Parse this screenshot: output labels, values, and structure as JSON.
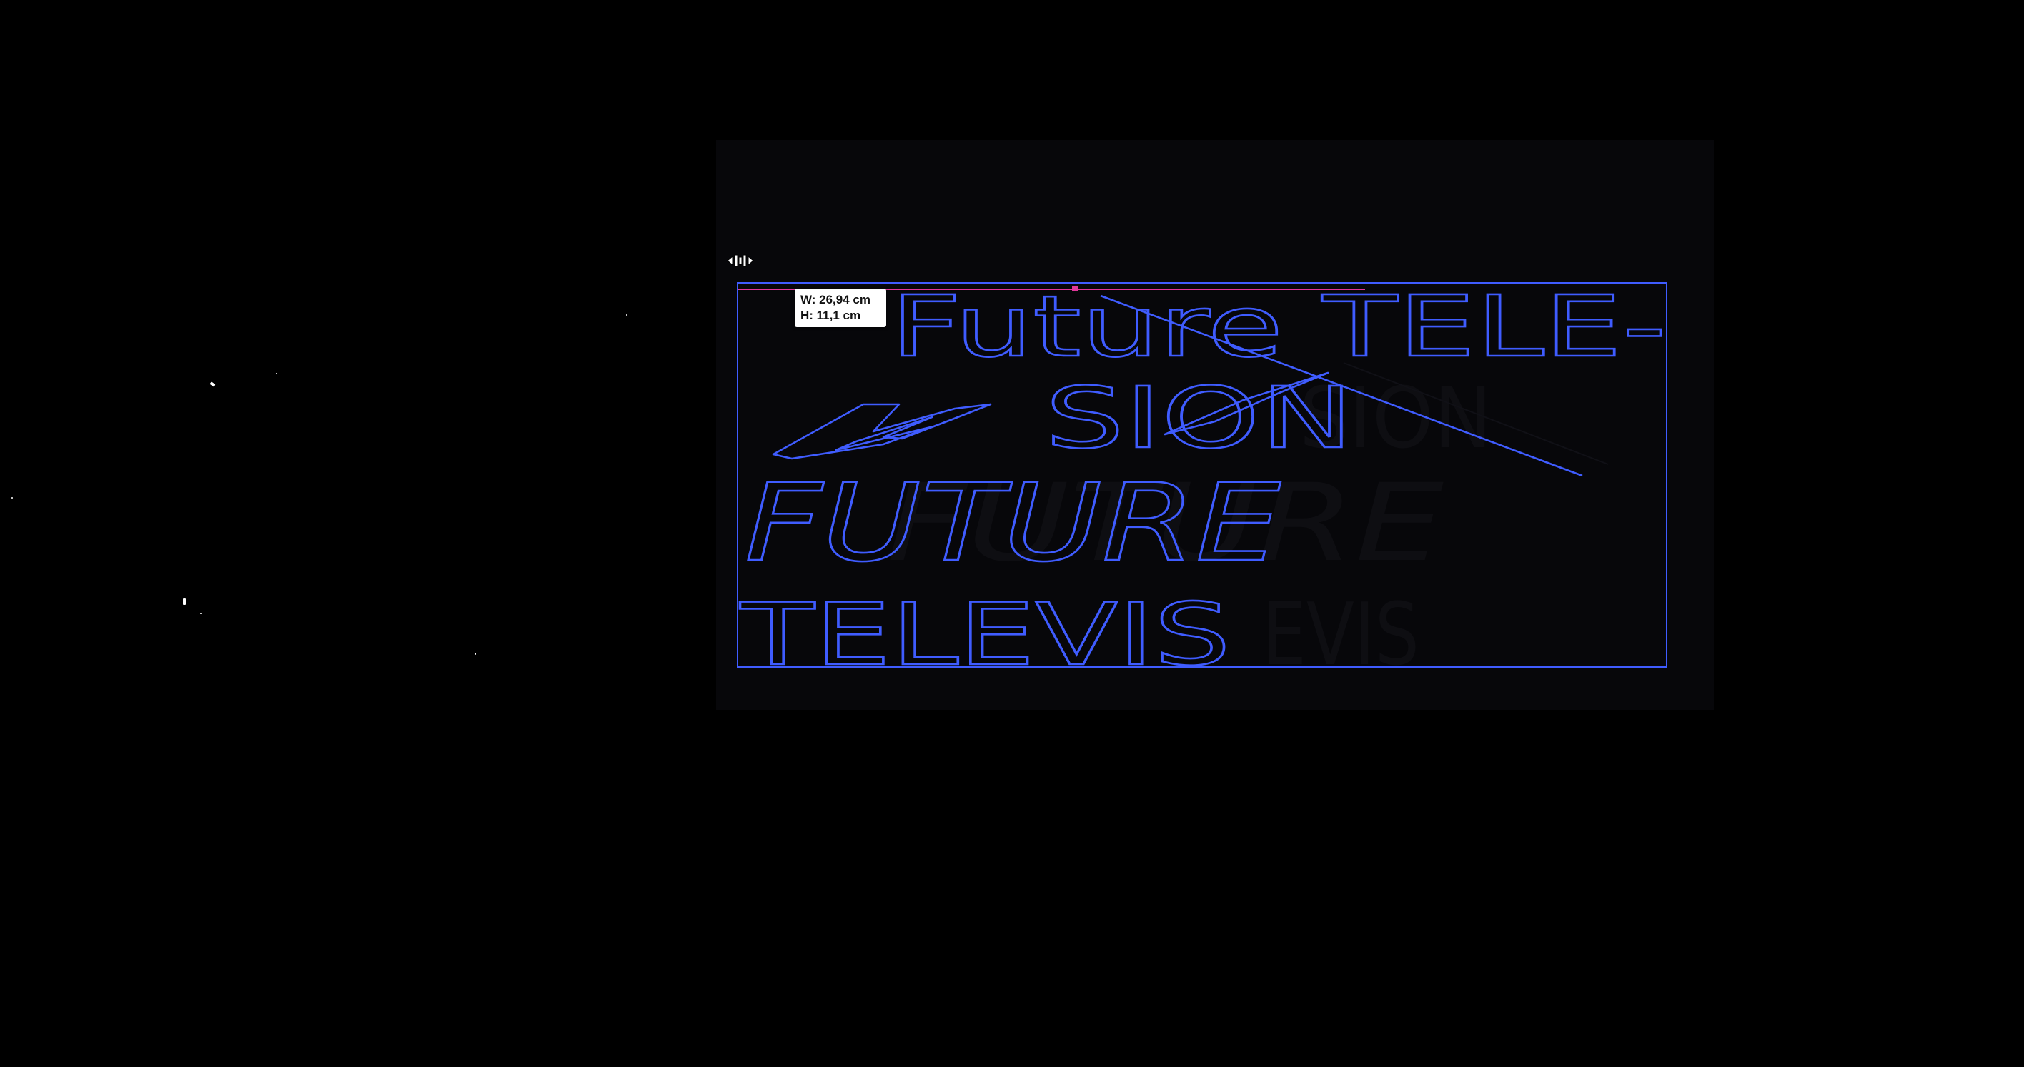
{
  "canvas": {
    "background": "#000000",
    "artboard_color": "#07070a",
    "accent_color": "#3f5cff",
    "guide_color": "#e0379a"
  },
  "artwork": {
    "line1": "Future TELE-",
    "line2": "SION",
    "line3": "FUTURE",
    "line4": "TELEVIS",
    "ghost_line2": "SION",
    "ghost_line3": "FUTURE",
    "ghost_line4": "EVIS"
  },
  "tooltip": {
    "width_label": "W: 26,94 cm",
    "height_label": "H: 11,1 cm"
  },
  "cursor": {
    "icon": "distribute-spacing-cursor-icon"
  }
}
